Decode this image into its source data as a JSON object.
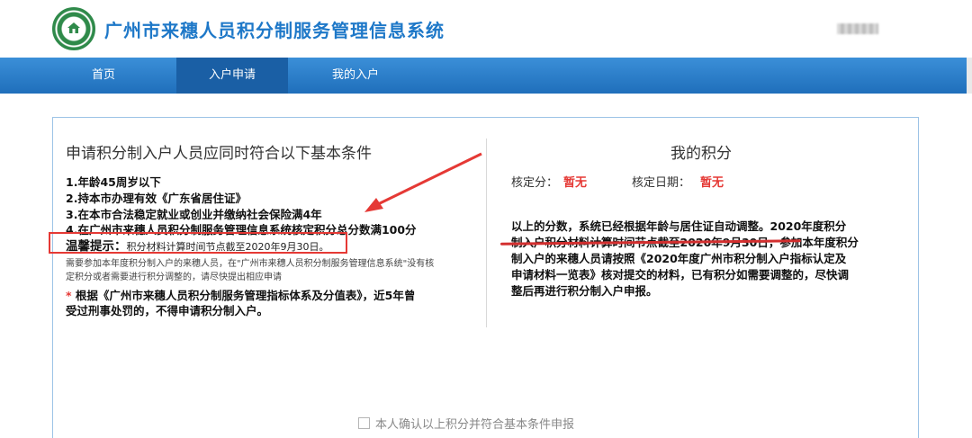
{
  "site": {
    "title": "广州市来穗人员积分制服务管理信息系统"
  },
  "nav": {
    "items": [
      {
        "label": "首页"
      },
      {
        "label": "入户申请"
      },
      {
        "label": "我的入户"
      }
    ]
  },
  "conditions": {
    "title": "申请积分制入户人员应同时符合以下基本条件",
    "items": [
      "1.年龄45周岁以下",
      "2.持本市办理有效《广东省居住证》",
      "3.在本市合法稳定就业或创业并缴纳社会保险满4年",
      "4.在广州市来穗人员积分制服务管理信息系统核定积分总分数满100分"
    ],
    "tip_label": "温馨提示：",
    "tip_text": "积分材料计算时间节点截至2020年9月30日。",
    "small_line1": "需要参加本年度积分制入户的来穗人员，在\"广州市来穗人员积分制服务管理信息系统\"没有核",
    "small_line2": "定积分或者需要进行积分调整的，请尽快提出相应申请",
    "note_star": "*",
    "note_line1": " 根据《广州市来穗人员积分制服务管理指标体系及分值表》，近5年曾",
    "note_line2": "受过刑事处罚的，不得申请积分制入户。"
  },
  "my_score": {
    "title": "我的积分",
    "approved_label": "核定分：",
    "approved_value": "暂无",
    "date_label": "核定日期：",
    "date_value": "暂无",
    "para_lines": [
      "以上的分数，系统已经根据年龄与居住证自动调整。2020年度积分",
      "制入户积分材料计算时间节点截至2020年9月30日，参加本年度积分",
      "制入户的来穗人员请按照《2020年度广州市积分制入户指标认定及",
      "申请材料一览表》核对提交的材料，已有积分如需要调整的，尽快调",
      "整后再进行积分制入户申报。"
    ]
  },
  "confirm": {
    "label": "本人确认以上积分并符合基本条件申报",
    "checked": false
  },
  "colors": {
    "brand_blue": "#1e78c8",
    "nav_blue": "#2a7fcc",
    "highlight_red": "#e53935"
  }
}
